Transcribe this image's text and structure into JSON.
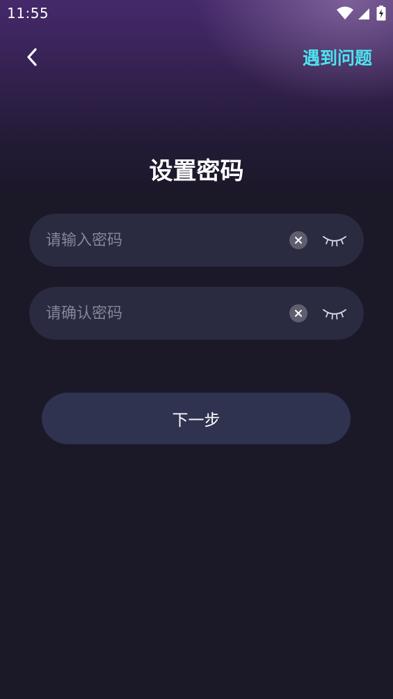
{
  "status_bar": {
    "time": "11:55",
    "icons": [
      "wifi-icon",
      "signal-icon",
      "battery-charging-icon"
    ]
  },
  "header": {
    "back_icon": "chevron-left-icon",
    "help_link": "遇到问题"
  },
  "title": "设置密码",
  "form": {
    "password": {
      "placeholder": "请输入密码",
      "value": ""
    },
    "confirm_password": {
      "placeholder": "请确认密码",
      "value": ""
    }
  },
  "next_button": "下一步",
  "colors": {
    "accent": "#4de3f0",
    "background": "#1b1828",
    "field_bg": "#2a2a40",
    "button_bg": "#2f3350"
  }
}
